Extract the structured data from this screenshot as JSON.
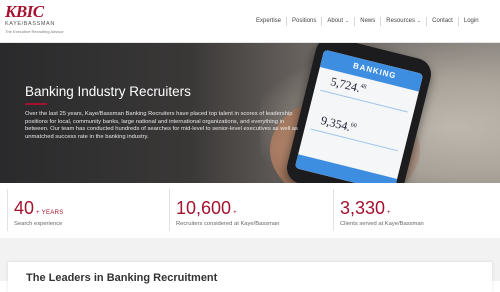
{
  "brand": {
    "logo_mark": "KBIC",
    "logo_sub": "KAYE/BASSMAN",
    "tagline": "The Executive Recruiting Advisor"
  },
  "nav": {
    "items": [
      {
        "label": "Expertise",
        "has_dropdown": false
      },
      {
        "label": "Positions",
        "has_dropdown": false
      },
      {
        "label": "About",
        "has_dropdown": true
      },
      {
        "label": "News",
        "has_dropdown": false
      },
      {
        "label": "Resources",
        "has_dropdown": true
      },
      {
        "label": "Contact",
        "has_dropdown": false
      },
      {
        "label": "Login",
        "has_dropdown": false
      }
    ]
  },
  "hero": {
    "title": "Banking Industry Recruiters",
    "body": "Over the last 25 years, Kaye/Bassman Banking Recruiters have placed top talent in scores of leadership positions for local, community banks, large national and international organizations, and everything in between. Our team has conducted hundreds of searches for mid-level to senior-level executives as well as unmatched success rate in the banking industry.",
    "phone": {
      "header": "BANKING",
      "value_1": "5,724.",
      "value_1_cents": "48",
      "value_2": "9,354.",
      "value_2_cents": "60"
    }
  },
  "stats": [
    {
      "number": "40",
      "suffix": "+ YEARS",
      "label": "Search experience"
    },
    {
      "number": "10,600",
      "suffix": "+",
      "label": "Recruiters considered at Kaye/Bassman"
    },
    {
      "number": "3,330",
      "suffix": "+",
      "label": "Clients served at Kaye/Bassman"
    }
  ],
  "section": {
    "title": "The Leaders in Banking Recruitment"
  },
  "colors": {
    "accent": "#a3122e",
    "phone_blue": "#3d8ee0"
  }
}
